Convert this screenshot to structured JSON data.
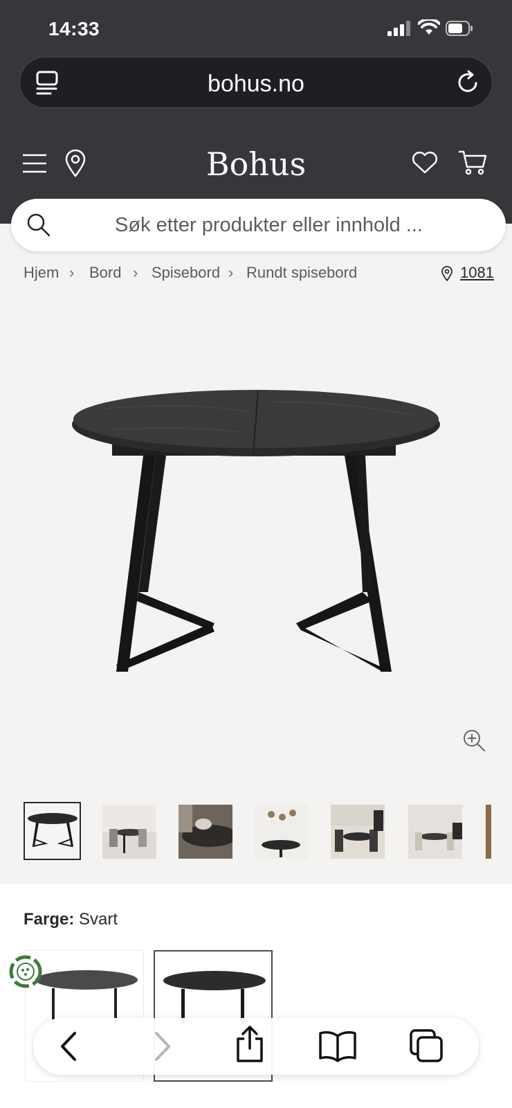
{
  "status_bar": {
    "time": "14:33"
  },
  "browser": {
    "url": "bohus.no"
  },
  "site": {
    "logo": "Bohus"
  },
  "search": {
    "placeholder": "Søk etter produkter eller innhold ..."
  },
  "breadcrumb": {
    "items": [
      "Hjem",
      "Bord",
      "Spisebord",
      "Rundt spisebord"
    ],
    "store_code": "1081"
  },
  "product": {
    "color_label": "Farge:",
    "color_value": "Svart"
  },
  "icons": {
    "status": [
      "signal-icon",
      "wifi-icon",
      "battery-icon"
    ],
    "urlbar": [
      "reader-icon",
      "reload-icon"
    ],
    "nav": [
      "menu-icon",
      "location-pin-icon",
      "heart-icon",
      "cart-icon"
    ],
    "search": "search-icon",
    "gallery": "zoom-in-icon",
    "browser_toolbar": [
      "back-icon",
      "forward-icon",
      "share-icon",
      "bookmarks-icon",
      "tabs-icon"
    ]
  },
  "colors": {
    "header_bg": "#37363b",
    "urlbar_bg": "#1f1e22",
    "page_bg": "#f4f3f2"
  }
}
